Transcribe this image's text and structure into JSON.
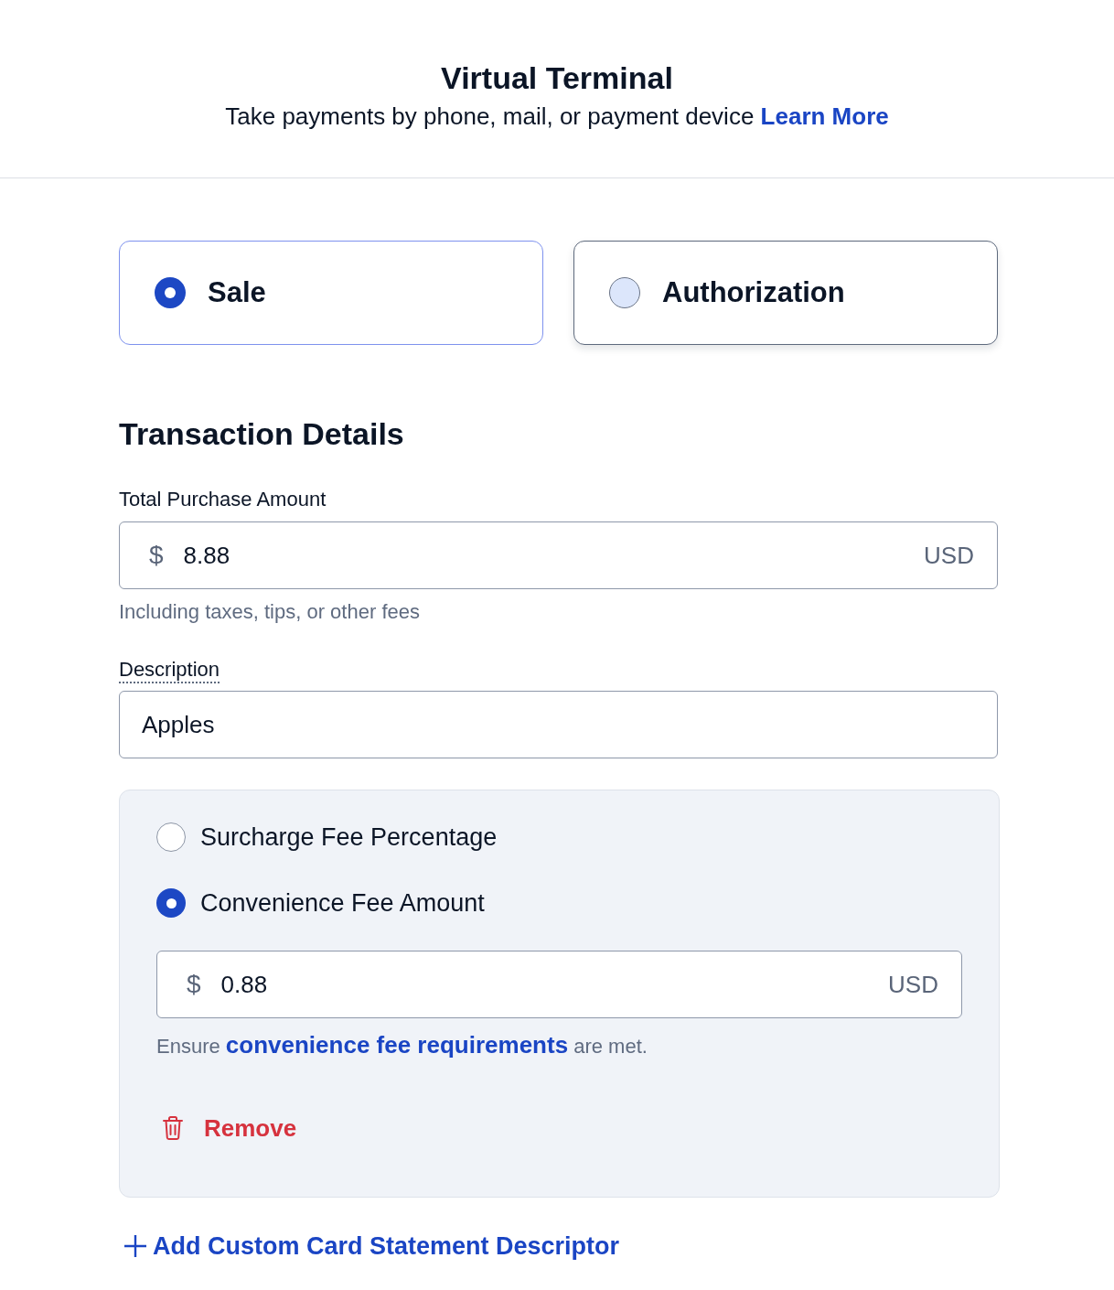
{
  "header": {
    "title": "Virtual Terminal",
    "subtitle": "Take payments by phone, mail, or payment device",
    "link": "Learn More"
  },
  "transaction_types": [
    {
      "label": "Sale",
      "selected": true
    },
    {
      "label": "Authorization",
      "selected": false
    }
  ],
  "transaction_details": {
    "title": "Transaction Details",
    "total_purchase_amount": {
      "label": "Total Purchase Amount",
      "symbol": "$",
      "value": "8.88",
      "currency": "USD",
      "hint": "Including taxes, tips, or other fees"
    },
    "description": {
      "label": "Description",
      "value": "Apples"
    }
  },
  "fee_panel": {
    "options": [
      {
        "label": "Surcharge Fee Percentage",
        "selected": false
      },
      {
        "label": "Convenience Fee Amount",
        "selected": true
      }
    ],
    "amount": {
      "symbol": "$",
      "value": "0.88",
      "currency": "USD"
    },
    "note": {
      "before": "Ensure",
      "link": "convenience fee requirements",
      "after": "are met."
    },
    "remove": "Remove"
  },
  "add_descriptor": "Add Custom Card Statement Descriptor"
}
